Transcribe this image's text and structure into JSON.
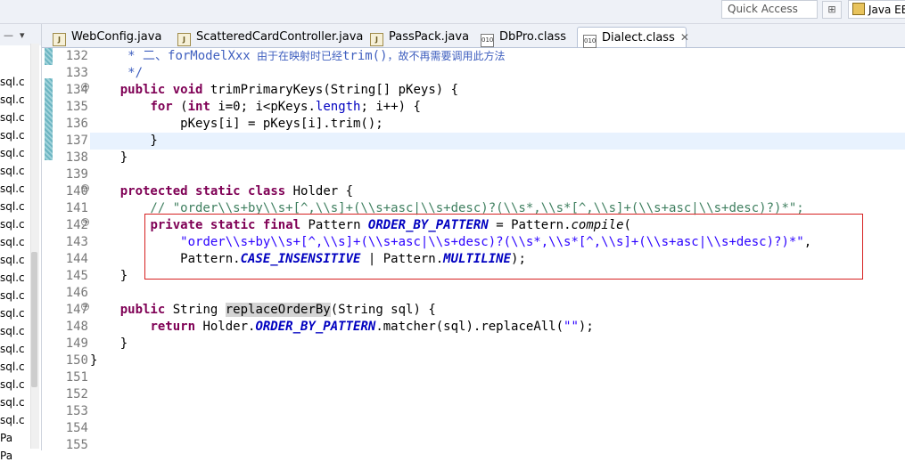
{
  "toolbar": {
    "quick_access": "Quick Access",
    "perspective": "Java EE"
  },
  "explorer": {
    "items": [
      "sql.c",
      "sql.c",
      "sql.c",
      "sql.c",
      "sql.c",
      "sql.c",
      "sql.c",
      "sql.c",
      "sql.c",
      "sql.c",
      "sql.c",
      "sql.c",
      "sql.c",
      "sql.c",
      "sql.c",
      "sql.c",
      "sql.c",
      "sql.c",
      "sql.c",
      "sql.c",
      "Pa",
      "Pa"
    ]
  },
  "tabs": [
    {
      "label": "WebConfig.java",
      "icon": "java-file-icon"
    },
    {
      "label": "ScatteredCardController.java",
      "icon": "java-file-icon"
    },
    {
      "label": "PassPack.java",
      "icon": "java-file-icon"
    },
    {
      "label": "DbPro.class",
      "icon": "class-file-icon"
    },
    {
      "label": "Dialect.class",
      "icon": "class-file-icon",
      "active": true
    }
  ],
  "editor": {
    "line_numbers": [
      "132",
      "133",
      "134",
      "135",
      "136",
      "137",
      "138",
      "139",
      "140",
      "141",
      "142",
      "143",
      "144",
      "145",
      "146",
      "147",
      "148",
      "149",
      "150",
      "151",
      "152",
      "153",
      "154",
      "155"
    ],
    "tokens": {
      "l132_a": "     * 二、",
      "l132_b": "forModelXxx",
      "l132_c": " 由于在映射时已经",
      "l132_d": "trim()",
      "l132_e": "，故不再需要调用此方法",
      "l133": "     */",
      "l134_kw1": "public",
      "l134_kw2": "void",
      "l134_rest": " trimPrimaryKeys(String[] pKeys) {",
      "l135_kw1": "for",
      "l135_a": " (",
      "l135_kw2": "int",
      "l135_b": " i=0; i<pKeys.",
      "l135_c": "length",
      "l135_d": "; i++) {",
      "l136": "            pKeys[i] = pKeys[i].trim();",
      "l137": "        }",
      "l138": "    }",
      "l140_kw1": "protected",
      "l140_kw2": "static",
      "l140_kw3": "class",
      "l140_rest": " Holder {",
      "l141": "        // \"order\\\\s+by\\\\s+[^,\\\\s]+(\\\\s+asc|\\\\s+desc)?(\\\\s*,\\\\s*[^,\\\\s]+(\\\\s+asc|\\\\s+desc)?)*\";",
      "l142_kw1": "private",
      "l142_kw2": "static",
      "l142_kw3": "final",
      "l142_a": " Pattern ",
      "l142_b": "ORDER_BY_PATTERN",
      "l142_c": " = Pattern.",
      "l142_d": "compile",
      "l142_e": "(",
      "l143_a": "            ",
      "l143_b": "\"order\\\\s+by\\\\s+[^,\\\\s]+(\\\\s+asc|\\\\s+desc)?(\\\\s*,\\\\s*[^,\\\\s]+(\\\\s+asc|\\\\s+desc)?)*\"",
      "l143_c": ",",
      "l144_a": "            Pattern.",
      "l144_b": "CASE_INSENSITIVE",
      "l144_c": " | Pattern.",
      "l144_d": "MULTILINE",
      "l144_e": ");",
      "l145": "    }",
      "l147_kw1": "public",
      "l147_a": " String ",
      "l147_b": "replaceOrderBy",
      "l147_c": "(String sql) {",
      "l148_kw1": "return",
      "l148_a": " Holder.",
      "l148_b": "ORDER_BY_PATTERN",
      "l148_c": ".matcher(sql).replaceAll(",
      "l148_d": "\"\"",
      "l148_e": ");",
      "l149": "    }",
      "l150": "}"
    }
  },
  "colors": {
    "keyword": "#7f0055",
    "comment": "#3f7f5f",
    "javadoc": "#3f5fbf",
    "string": "#2a00ff",
    "field": "#0000c0",
    "highlight_box": "#d62020",
    "current_line": "#e8f2fe"
  }
}
